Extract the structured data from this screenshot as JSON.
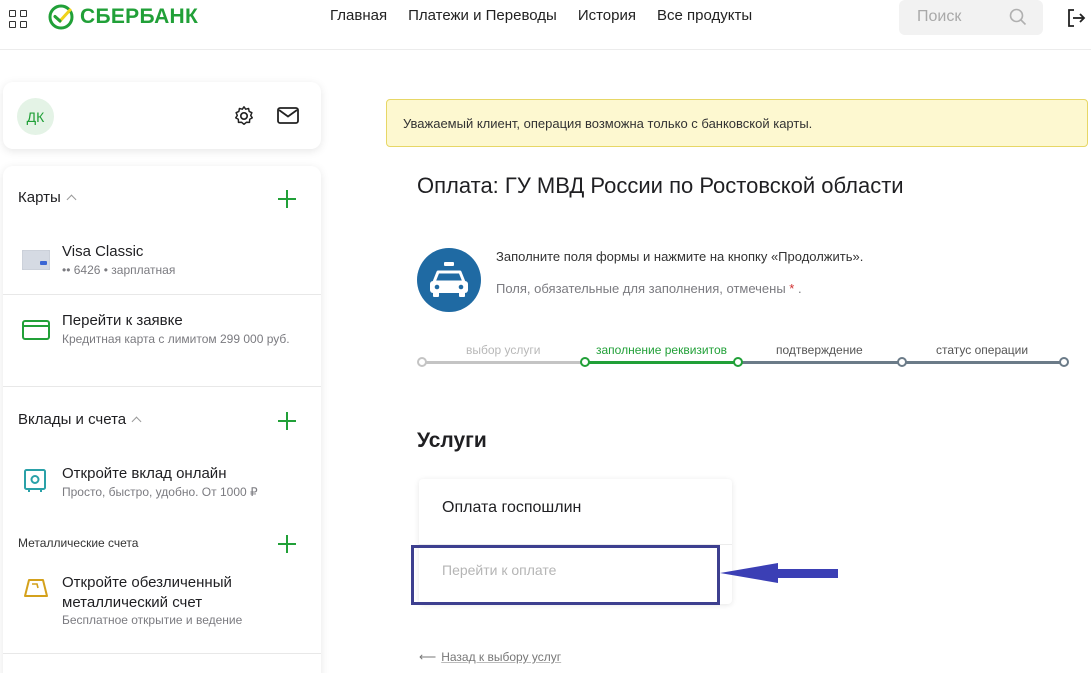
{
  "header": {
    "logo": "СБЕРБАНК",
    "nav": [
      "Главная",
      "Платежи и Переводы",
      "История",
      "Все продукты"
    ],
    "search_placeholder": "Поиск"
  },
  "profile": {
    "initials": "ДК"
  },
  "sidebar": {
    "cards_title": "Карты",
    "card1_title": "Visa Classic",
    "card1_sub": "•• 6426 • зарплатная",
    "card2_title": "Перейти к заявке",
    "card2_sub": "Кредитная карта с лимитом 299 000 руб.",
    "deposits_title": "Вклады и счета",
    "deposit_title": "Откройте вклад онлайн",
    "deposit_sub": "Просто, быстро, удобно. От 1000 ₽",
    "metal_title": "Металлические счета",
    "metal_item_title": "Откройте обезличенный металлический счет",
    "metal_item_sub": "Бесплатное открытие и ведение"
  },
  "main": {
    "alert": "Уважаемый клиент, операция возможна только с банковской карты.",
    "title": "Оплата: ГУ МВД России по Ростовской  области",
    "hint1": "Заполните поля формы и нажмите на кнопку «Продолжить».",
    "hint2": "Поля, обязательные для заполнения, отмечены",
    "hint2_star": "*",
    "hint2_end": ".",
    "steps": [
      "выбор услуги",
      "заполнение реквизитов",
      "подтверждение",
      "статус операции"
    ],
    "active_step": 1,
    "services_title": "Услуги",
    "service_name": "Оплата госпошлин",
    "service_button": "Перейти к оплате",
    "back_link": "Назад к выбору услуг",
    "back_arrow": "⟵"
  },
  "colors": {
    "brand": "#21a038",
    "step_done": "#c4c4c4",
    "step_active": "#21a038",
    "step_pending": "#6b7b88",
    "highlight": "#3d3f8f"
  }
}
